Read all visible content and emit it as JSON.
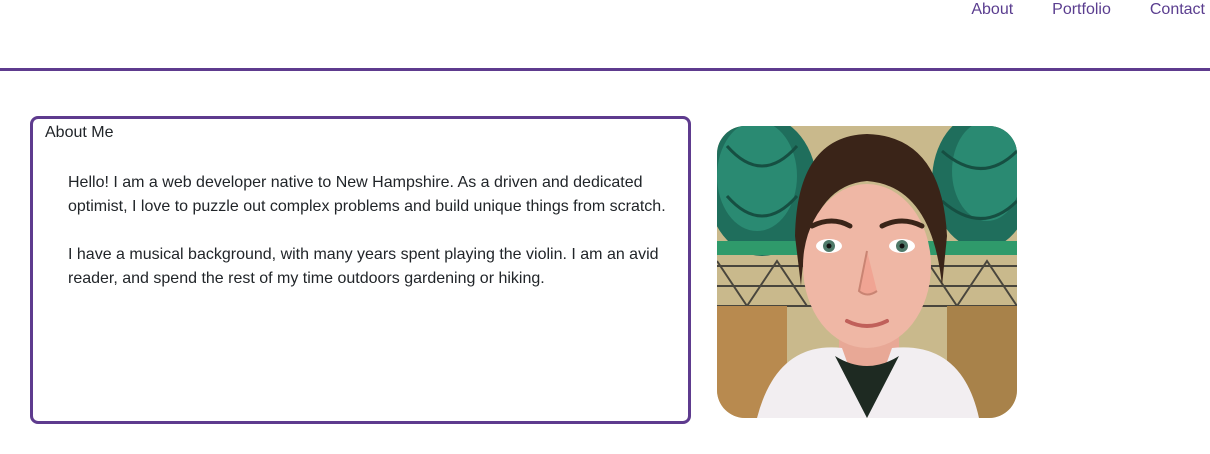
{
  "nav": {
    "items": [
      {
        "label": "About"
      },
      {
        "label": "Portfolio"
      },
      {
        "label": "Contact"
      }
    ]
  },
  "about": {
    "title": "About Me",
    "paragraphs": [
      "Hello! I am a web developer native to New Hampshire. As a driven and dedicated optimist, I love to puzzle out complex problems and build unique things from scratch.",
      "I have a musical background, with many years spent playing the violin. I am an avid reader, and spend the rest of my time outdoors gardening or hiking."
    ]
  },
  "colors": {
    "accent": "#5e3b8e",
    "nav_link": "#5a3d8f"
  }
}
